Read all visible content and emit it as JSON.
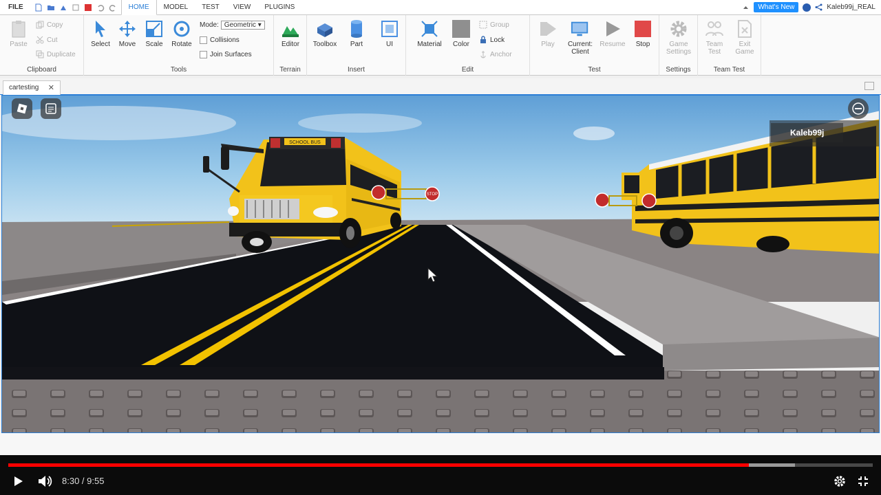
{
  "ribbon_tabs": [
    "FILE",
    "HOME",
    "MODEL",
    "TEST",
    "VIEW",
    "PLUGINS"
  ],
  "active_tab": "HOME",
  "top_right": {
    "whats_new": "What's New",
    "username": "Kaleb99j_REAL"
  },
  "clipboard": {
    "paste": "Paste",
    "copy": "Copy",
    "cut": "Cut",
    "duplicate": "Duplicate",
    "title": "Clipboard"
  },
  "tools": {
    "select": "Select",
    "move": "Move",
    "scale": "Scale",
    "rotate": "Rotate",
    "mode_label": "Mode:",
    "mode_value": "Geometric",
    "collisions": "Collisions",
    "join_surfaces": "Join Surfaces",
    "title": "Tools"
  },
  "terrain": {
    "editor": "Editor",
    "title": "Terrain"
  },
  "insert": {
    "toolbox": "Toolbox",
    "part": "Part",
    "ui": "UI",
    "title": "Insert"
  },
  "edit": {
    "material": "Material",
    "color": "Color",
    "group": "Group",
    "lock": "Lock",
    "anchor": "Anchor",
    "title": "Edit"
  },
  "test": {
    "play": "Play",
    "current_client": "Current: Client",
    "resume": "Resume",
    "stop": "Stop",
    "title": "Test"
  },
  "settings": {
    "game_settings": "Game Settings",
    "title": "Settings"
  },
  "team_test": {
    "team_test": "Team Test",
    "exit_game": "Exit Game",
    "title": "Team Test"
  },
  "document_tab": "cartesting",
  "viewport": {
    "player_name": "Kaleb99j",
    "bus_sign": "SCHOOL BUS",
    "stop_sign": "STOP"
  },
  "video": {
    "time_display": "8:30 / 9:55",
    "played_fraction": 0.857,
    "buffered_fraction": 0.91,
    "accent_color": "#ff0000"
  },
  "colors": {
    "accent": "#2a7ed6",
    "road": "#0f1116",
    "road_line": "#f2c200"
  }
}
